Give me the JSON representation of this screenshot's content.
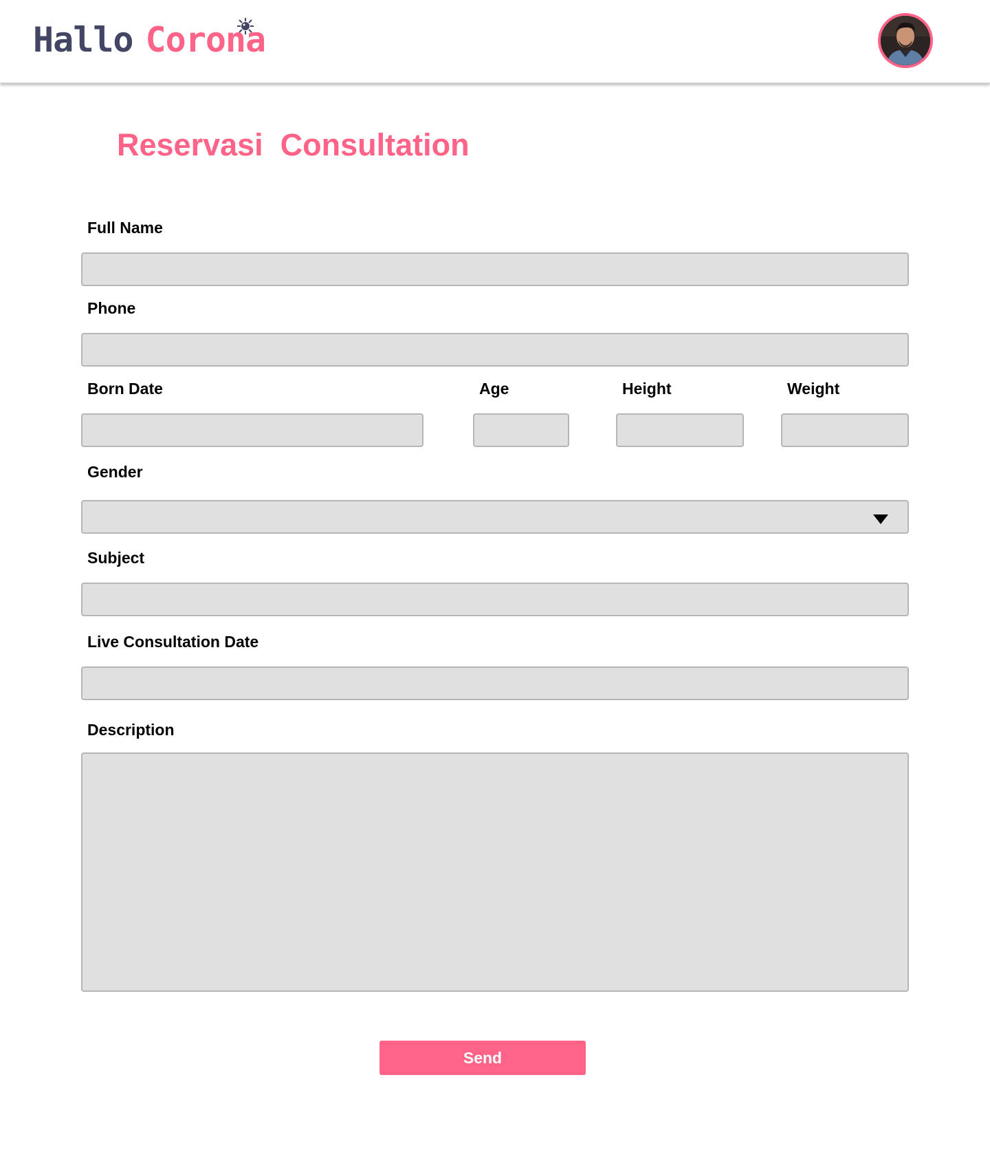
{
  "header": {
    "logo": {
      "word1": "Hallo",
      "word2": "Corona"
    },
    "avatar_icon": "user-avatar-photo",
    "colors": {
      "brand_pink": "#ff6388",
      "brand_navy": "#434564"
    }
  },
  "page": {
    "title": "Reservasi  Consultation"
  },
  "form": {
    "full_name": {
      "label": "Full Name",
      "value": ""
    },
    "phone": {
      "label": "Phone",
      "value": ""
    },
    "born_date": {
      "label": "Born Date",
      "value": ""
    },
    "age": {
      "label": "Age",
      "value": ""
    },
    "height": {
      "label": "Height",
      "value": ""
    },
    "weight": {
      "label": "Weight",
      "value": ""
    },
    "gender": {
      "label": "Gender",
      "value": "",
      "arrow_icon": "dropdown-triangle-icon"
    },
    "subject": {
      "label": "Subject",
      "value": ""
    },
    "live_consultation_date": {
      "label": "Live Consultation Date",
      "value": ""
    },
    "description": {
      "label": "Description",
      "value": ""
    },
    "send_label": "Send"
  },
  "colors": {
    "field_bg": "#e0e0e0",
    "field_border": "#b6b6b6",
    "accent": "#ff6388"
  }
}
